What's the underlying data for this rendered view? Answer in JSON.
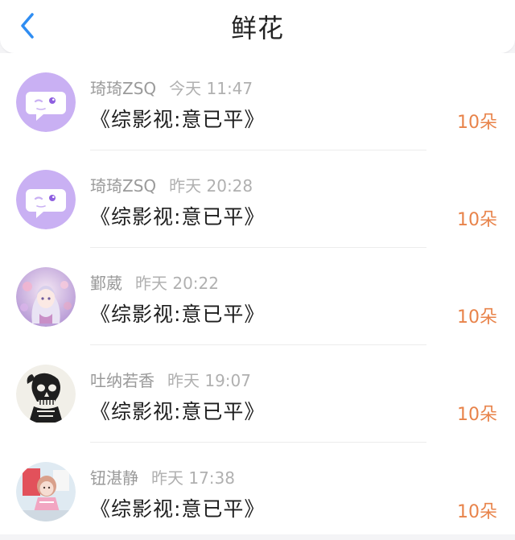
{
  "header": {
    "title": "鲜花",
    "back_icon": "chevron-left-icon",
    "accent_color": "#2f8df2"
  },
  "items": [
    {
      "user": "琦琦ZSQ",
      "time": "今天 11:47",
      "book": "《综影视:意已平》",
      "count": "10朵",
      "avatar": "chat-bubble-avatar"
    },
    {
      "user": "琦琦ZSQ",
      "time": "昨天 20:28",
      "book": "《综影视:意已平》",
      "count": "10朵",
      "avatar": "chat-bubble-avatar"
    },
    {
      "user": "鄞葳",
      "time": "昨天 20:22",
      "book": "《综影视:意已平》",
      "count": "10朵",
      "avatar": "anime-girl-avatar"
    },
    {
      "user": "吐纳若香",
      "time": "昨天 19:07",
      "book": "《综影视:意已平》",
      "count": "10朵",
      "avatar": "skull-avatar"
    },
    {
      "user": "钮湛静",
      "time": "昨天 17:38",
      "book": "《综影视:意已平》",
      "count": "10朵",
      "avatar": "doll-avatar"
    }
  ],
  "colors": {
    "count_orange": "#e8834a",
    "avatar_purple": "#c9b0f3"
  }
}
